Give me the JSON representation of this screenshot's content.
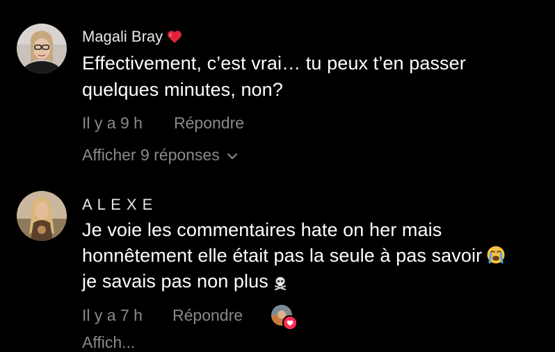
{
  "comments": [
    {
      "username": "Magali Bray",
      "badge_icon": "red-heart-icon",
      "lines": [
        "Effectivement, c’est vrai… tu peux t’en passer",
        "quelques minutes, non?"
      ],
      "time": "Il y a 9 h",
      "reply_label": "Répondre",
      "view_replies": "Afficher 9 réponses"
    },
    {
      "username": "A L E X E",
      "lines": [
        "Je voie les commentaires hate on her mais",
        "honnêtement elle était pas la seule à pas savoir",
        "je savais pas non plus"
      ],
      "line_emojis": [
        "",
        "loudly-crying-face-icon",
        "skull-crossbones-icon"
      ],
      "time": "Il y a 7 h",
      "reply_label": "Répondre",
      "creator_liked_icon": "creator-liked-heart-icon",
      "partial_next": "Affich..."
    }
  ],
  "colors": {
    "background": "#000000",
    "text": "#ffffff",
    "muted": "#8a8a8a",
    "like": "#fe2c55"
  }
}
